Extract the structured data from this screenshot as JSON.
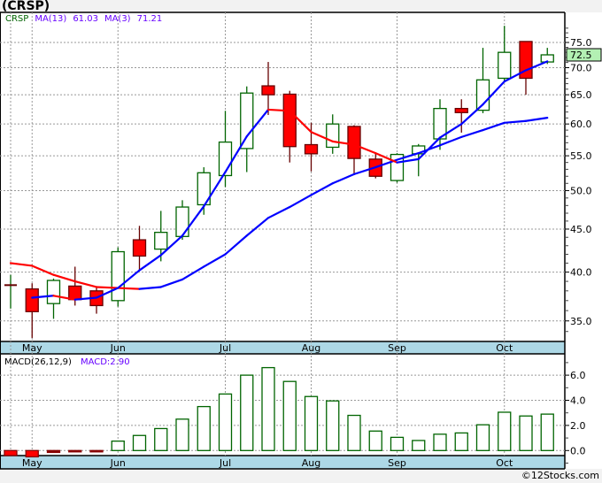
{
  "title": "(CRSP)",
  "watermark": "©12Stocks.com",
  "legend": {
    "symbol": "CRSP",
    "ma_long_label": "MA(13)",
    "ma_long_value": "61.03",
    "ma_short_label": "MA(3)",
    "ma_short_value": "71.21"
  },
  "macd_legend": {
    "label": "MACD(26,12,9)",
    "value_label": "MACD:2.90"
  },
  "current_price_label": "72.5",
  "colors": {
    "up": "#006400",
    "down": "#ff0000",
    "ma_rising": "#0000ff",
    "ma_falling": "#ff0000",
    "axis_band": "#add8e6",
    "price_tag": "#b3f0b3",
    "ma_label": "#6600ff"
  },
  "chart_data": [
    {
      "type": "candlestick",
      "title": "(CRSP)",
      "yscale": "log",
      "ylim": [
        33.4,
        80
      ],
      "grid": true,
      "y_ticks": [
        "75.0",
        "70.0",
        "65.0",
        "60.0",
        "55.0",
        "50.0",
        "45.0",
        "40.0",
        "35.0"
      ],
      "x_ticks": [
        {
          "label": "May",
          "index": 1
        },
        {
          "label": "Jun",
          "index": 5
        },
        {
          "label": "Jul",
          "index": 10
        },
        {
          "label": "Aug",
          "index": 14
        },
        {
          "label": "Sep",
          "index": 18
        },
        {
          "label": "Oct",
          "index": 23
        }
      ],
      "ohlc": [
        [
          38.6,
          39.7,
          36.2,
          38.6
        ],
        [
          38.2,
          38.8,
          33.4,
          35.9
        ],
        [
          36.7,
          39.3,
          35.2,
          39.1
        ],
        [
          38.5,
          40.6,
          36.5,
          37.1
        ],
        [
          38.0,
          38.4,
          35.7,
          36.5
        ],
        [
          37.0,
          42.8,
          36.4,
          42.3
        ],
        [
          43.7,
          45.4,
          40.2,
          41.8
        ],
        [
          42.6,
          47.3,
          41.2,
          44.6
        ],
        [
          44.1,
          48.7,
          43.7,
          47.8
        ],
        [
          48.1,
          53.3,
          46.8,
          52.5
        ],
        [
          52.1,
          62.2,
          50.5,
          57.1
        ],
        [
          56.1,
          66.5,
          52.6,
          65.3
        ],
        [
          66.6,
          71.1,
          61.5,
          65.0
        ],
        [
          65.1,
          65.7,
          54.0,
          56.4
        ],
        [
          56.7,
          60.2,
          52.7,
          55.3
        ],
        [
          56.3,
          61.6,
          55.3,
          60.0
        ],
        [
          59.6,
          59.8,
          52.3,
          54.6
        ],
        [
          54.5,
          55.4,
          51.7,
          52.0
        ],
        [
          51.4,
          55.4,
          51.1,
          55.2
        ],
        [
          55.3,
          56.8,
          52.0,
          56.5
        ],
        [
          57.6,
          64.2,
          55.9,
          62.6
        ],
        [
          62.6,
          64.2,
          58.6,
          61.9
        ],
        [
          62.3,
          73.9,
          61.8,
          67.7
        ],
        [
          68.0,
          78.5,
          67.5,
          73.0
        ],
        [
          75.2,
          75.2,
          65.0,
          68.0
        ],
        [
          71.1,
          73.9,
          70.7,
          72.5
        ]
      ],
      "series": [
        {
          "name": "MA(13)",
          "start_index": 0,
          "values": [
            41.0,
            40.7,
            39.7,
            39.0,
            38.4,
            38.3,
            38.2,
            38.4,
            39.2,
            40.6,
            42.0,
            44.2,
            46.4,
            47.8,
            49.4,
            51.0,
            52.3,
            53.3,
            54.4,
            55.4,
            56.6,
            57.9,
            59.0,
            60.2,
            60.5,
            61.03
          ]
        },
        {
          "name": "MA(3)",
          "start_index": 1,
          "values": [
            37.3,
            37.5,
            37.1,
            37.3,
            38.3,
            40.2,
            41.9,
            44.2,
            47.9,
            52.6,
            58.0,
            62.4,
            62.2,
            58.7,
            57.2,
            56.7,
            55.4,
            54.0,
            54.5,
            57.8,
            60.0,
            63.3,
            67.4,
            69.5,
            71.21
          ]
        }
      ]
    },
    {
      "type": "bar",
      "title": "MACD(26,12,9)",
      "ylim": [
        -1,
        7
      ],
      "grid": true,
      "y_ticks": [
        "6.0",
        "4.0",
        "2.0",
        "0.0"
      ],
      "values": [
        -0.4,
        -0.5,
        -0.15,
        -0.05,
        -0.05,
        0.75,
        1.2,
        1.75,
        2.5,
        3.5,
        4.5,
        6.0,
        6.6,
        5.5,
        4.3,
        3.95,
        2.8,
        1.55,
        1.05,
        0.8,
        1.3,
        1.4,
        2.05,
        3.05,
        2.75,
        2.9
      ]
    }
  ]
}
